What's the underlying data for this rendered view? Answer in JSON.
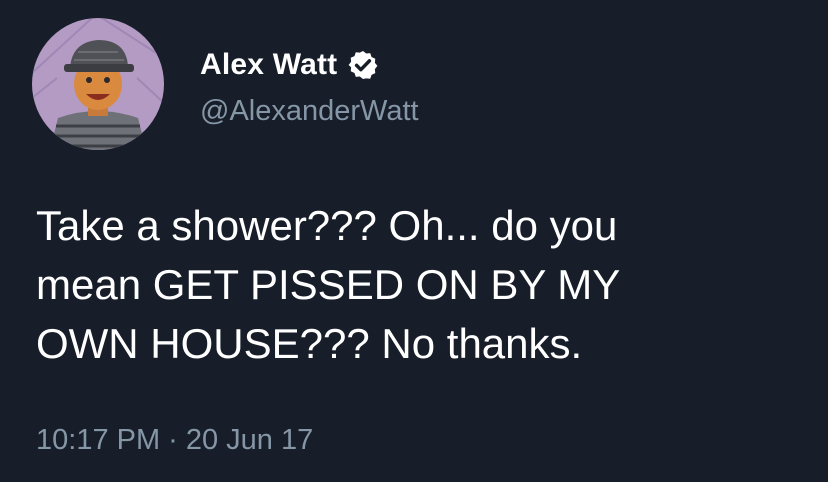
{
  "colors": {
    "background": "#171e29",
    "text": "#ffffff",
    "secondary_text": "#8596a6",
    "verified_badge": "#ffffff"
  },
  "author": {
    "display_name": "Alex Watt",
    "handle": "@AlexanderWatt",
    "verified": true,
    "avatar_icon": "drawn-portrait-avatar",
    "verified_icon": "verified-badge-icon"
  },
  "tweet": {
    "text": "Take a shower??? Oh... do you\nmean GET PISSED ON BY MY\nOWN HOUSE??? No thanks.",
    "time": "10:17 PM",
    "separator": "·",
    "date": "20 Jun 17"
  }
}
